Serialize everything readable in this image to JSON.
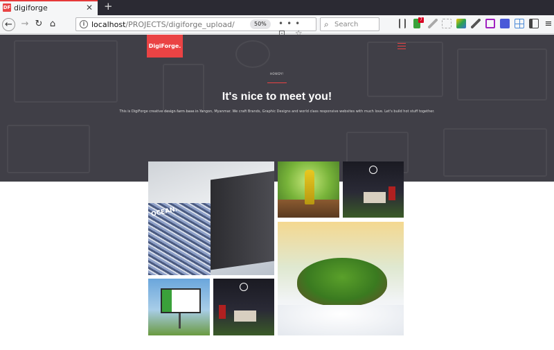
{
  "browser": {
    "tab": {
      "favicon_text": "DF",
      "title": "digiforge",
      "close": "✕"
    },
    "new_tab": "+",
    "nav": {
      "back": "←",
      "forward": "→",
      "reload": "↻",
      "home": "⌂"
    },
    "url": {
      "host": "localhost",
      "path": "/PROJECTS/digiforge_upload/"
    },
    "zoom": "50%",
    "url_actions": "••• ⊡ ☆",
    "search_placeholder": "Search",
    "extension_badge": "7",
    "menu": "≡"
  },
  "site": {
    "logo": "DigiForge.",
    "kicker": "HOWDY!",
    "title": "It's nice to meet you!",
    "subtitle": "This is DigiForge creative design farm base in Yangon, Myanmar. We craft Brands, Graphic Designs and world class responsive websites with much love. Let's build hot stuff together."
  },
  "colors": {
    "brand": "#ea4344",
    "hero_bg": "#403f47"
  },
  "portfolio": [
    {
      "name": "brochure",
      "label": "OCEAN."
    },
    {
      "name": "oil-bottle",
      "label": ""
    },
    {
      "name": "office-scene",
      "label": ""
    },
    {
      "name": "floating-island",
      "label": ""
    },
    {
      "name": "billboard",
      "label": ""
    },
    {
      "name": "office-scene-2",
      "label": ""
    }
  ]
}
